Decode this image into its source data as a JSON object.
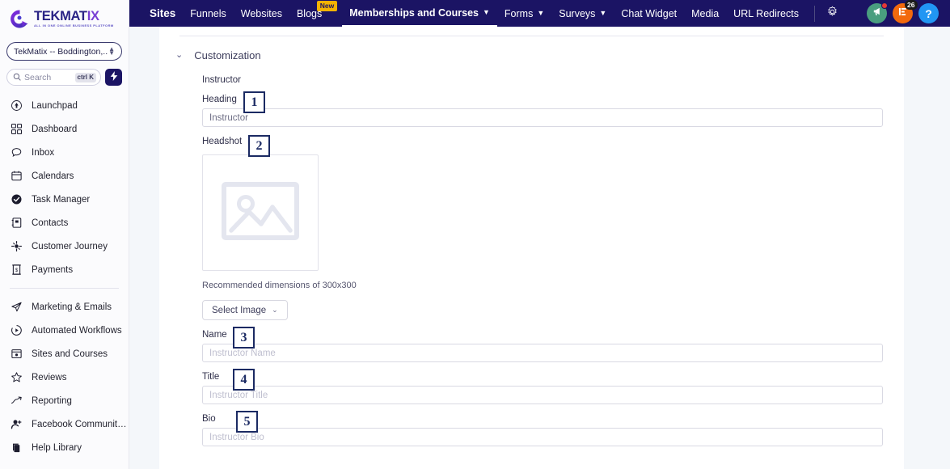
{
  "topnav": {
    "items": [
      {
        "label": "Sites",
        "active": false,
        "bold": true,
        "caret": false,
        "badge": null
      },
      {
        "label": "Funnels",
        "active": false,
        "bold": false,
        "caret": false,
        "badge": null
      },
      {
        "label": "Websites",
        "active": false,
        "bold": false,
        "caret": false,
        "badge": null
      },
      {
        "label": "Blogs",
        "active": false,
        "bold": false,
        "caret": false,
        "badge": "New"
      },
      {
        "label": "Memberships and Courses",
        "active": true,
        "bold": true,
        "caret": true,
        "badge": null
      },
      {
        "label": "Forms",
        "active": false,
        "bold": false,
        "caret": true,
        "badge": null
      },
      {
        "label": "Surveys",
        "active": false,
        "bold": false,
        "caret": true,
        "badge": null
      },
      {
        "label": "Chat Widget",
        "active": false,
        "bold": false,
        "caret": false,
        "badge": null
      },
      {
        "label": "Media",
        "active": false,
        "bold": false,
        "caret": false,
        "badge": null
      },
      {
        "label": "URL Redirects",
        "active": false,
        "bold": false,
        "caret": false,
        "badge": null
      }
    ],
    "settings_icon": "gear-icon",
    "right_icons": [
      {
        "name": "announcement-icon",
        "color": "#4a9e7f",
        "dot": true,
        "count": null
      },
      {
        "name": "notifications-icon",
        "color": "#f2690d",
        "dot": false,
        "count": "26"
      },
      {
        "name": "help-icon",
        "color": "#2196f3",
        "dot": false,
        "count": null,
        "glyph": "?"
      }
    ],
    "accent_color": "#1b1464",
    "badge_color": "#f5b301"
  },
  "sidebar": {
    "logo": {
      "word_main": "TEKMAT",
      "word_accent": "IX",
      "tagline": "ALL IN ONE ONLINE BUSINESS PLATFORM"
    },
    "account": {
      "name": "TekMatix -- Boddington,..."
    },
    "search": {
      "placeholder": "Search",
      "shortcut": "ctrl K"
    },
    "items_group_one": [
      {
        "label": "Launchpad",
        "icon": "rocket-icon"
      },
      {
        "label": "Dashboard",
        "icon": "dashboard-grid-icon"
      },
      {
        "label": "Inbox",
        "icon": "chat-bubble-icon"
      },
      {
        "label": "Calendars",
        "icon": "calendar-icon"
      },
      {
        "label": "Task Manager",
        "icon": "check-circle-icon"
      },
      {
        "label": "Contacts",
        "icon": "contacts-book-icon"
      },
      {
        "label": "Customer Journey",
        "icon": "journey-node-icon"
      },
      {
        "label": "Payments",
        "icon": "payments-icon"
      }
    ],
    "items_group_two": [
      {
        "label": "Marketing & Emails",
        "icon": "paper-plane-icon"
      },
      {
        "label": "Automated Workflows",
        "icon": "play-circle-icon"
      },
      {
        "label": "Sites and Courses",
        "icon": "browser-window-icon"
      },
      {
        "label": "Reviews",
        "icon": "star-icon"
      },
      {
        "label": "Reporting",
        "icon": "trend-up-icon"
      },
      {
        "label": "Facebook Community G...",
        "icon": "user-plus-icon"
      },
      {
        "label": "Help Library",
        "icon": "books-icon"
      }
    ]
  },
  "main": {
    "section": {
      "title": "Customization",
      "chevron": "chevron-down-icon"
    },
    "group_label": "Instructor",
    "fields": [
      {
        "badge": "1",
        "label": "Heading",
        "value": "Instructor",
        "placeholder": "",
        "type": "text"
      },
      {
        "badge": "2",
        "label": "Headshot",
        "type": "image"
      },
      {
        "badge": "3",
        "label": "Name",
        "value": "",
        "placeholder": "Instructor Name",
        "type": "text"
      },
      {
        "badge": "4",
        "label": "Title",
        "value": "",
        "placeholder": "Instructor Title",
        "type": "text"
      },
      {
        "badge": "5",
        "label": "Bio",
        "value": "",
        "placeholder": "Instructor Bio",
        "type": "text"
      }
    ],
    "headshot": {
      "recommended_text": "Recommended dimensions of 300x300",
      "select_button": "Select Image",
      "placeholder_icon": "image-placeholder-icon"
    }
  }
}
